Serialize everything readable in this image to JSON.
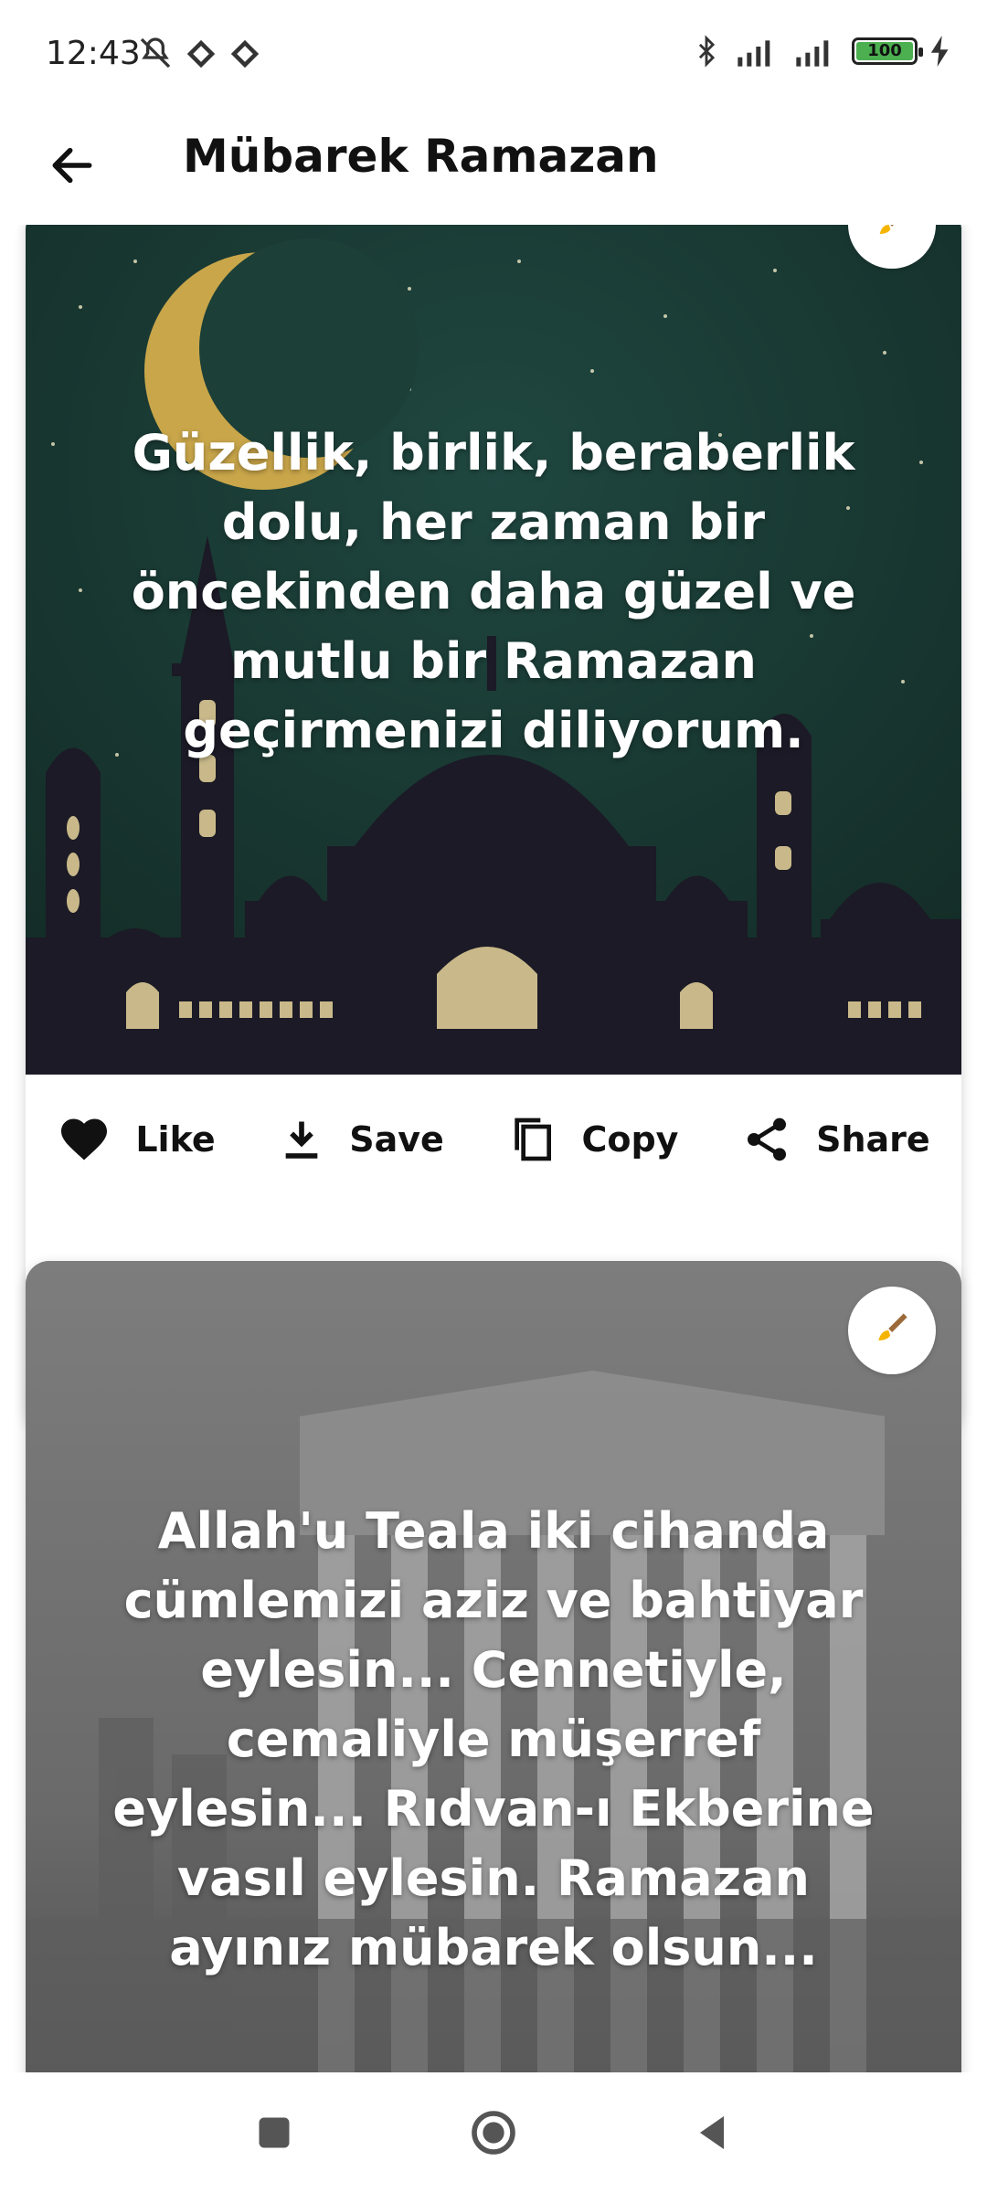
{
  "status_bar": {
    "time": "12:43",
    "battery": "100",
    "icons": [
      "mute-icon",
      "signal-icon",
      "signal-icon",
      "bluetooth-icon",
      "cell-signal-icon",
      "cell-signal-icon",
      "battery-icon",
      "charging-icon"
    ]
  },
  "app_bar": {
    "title": "Mübarek Ramazan",
    "back_icon": "arrow-left-icon"
  },
  "cards": [
    {
      "quote": "Güzellik, birlik, beraberlik dolu, her zaman bir öncekinden daha güzel ve mutlu bir Ramazan geçirmenizi diliyorum.",
      "theme": "night-mosque",
      "actions": {
        "like": "Like",
        "save": "Save",
        "copy": "Copy",
        "share": "Share"
      }
    },
    {
      "quote": "Allah'u Teala iki cihanda cümlemizi aziz ve bahtiyar eylesin... Cennetiyle, cemaliyle müşerref eylesin... Rıdvan-ı Ekberine vasıl eylesin. Ramazan ayınız mübarek olsun...",
      "theme": "greyscale-ruins"
    }
  ],
  "colors": {
    "night_sky": "#1d3f38",
    "moon": "#c9a64a",
    "mosque_silhouette": "#1a1a24",
    "window_light": "#c9b98a",
    "paint_icon": "#f5b400"
  },
  "nav_bar": {
    "recents_icon": "square-icon",
    "home_icon": "circle-icon",
    "back_icon": "triangle-back-icon"
  }
}
